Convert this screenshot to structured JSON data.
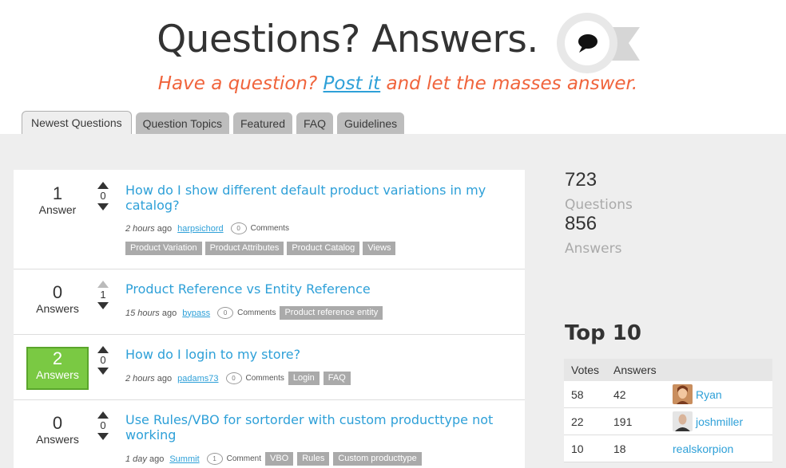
{
  "header": {
    "title": "Questions? Answers.",
    "tagline_before": "Have a question?",
    "tagline_link": "Post it",
    "tagline_after": "and let the masses answer."
  },
  "tabs": [
    {
      "label": "Newest Questions",
      "active": true
    },
    {
      "label": "Question Topics",
      "active": false
    },
    {
      "label": "Featured",
      "active": false
    },
    {
      "label": "FAQ",
      "active": false
    },
    {
      "label": "Guidelines",
      "active": false
    }
  ],
  "questions": [
    {
      "answers": "1",
      "answers_label": "Answer",
      "accepted": false,
      "votes": "0",
      "title": "How do I show different default product variations in my catalog?",
      "ago": "2 hours",
      "ago_suffix": "ago",
      "user": "harpsichord",
      "comments": "0",
      "comments_label": "Comments",
      "tags": [
        "Product Variation",
        "Product Attributes",
        "Product Catalog",
        "Views"
      ]
    },
    {
      "answers": "0",
      "answers_label": "Answers",
      "accepted": false,
      "votes": "1",
      "title": "Product Reference vs Entity Reference",
      "ago": "15 hours",
      "ago_suffix": "ago",
      "user": "bypass",
      "comments": "0",
      "comments_label": "Comments",
      "tags": [
        "Product reference entity"
      ]
    },
    {
      "answers": "2",
      "answers_label": "Answers",
      "accepted": true,
      "votes": "0",
      "title": "How do I login to my store?",
      "ago": "2 hours",
      "ago_suffix": "ago",
      "user": "padams73",
      "comments": "0",
      "comments_label": "Comments",
      "tags": [
        "Login",
        "FAQ"
      ]
    },
    {
      "answers": "0",
      "answers_label": "Answers",
      "accepted": false,
      "votes": "0",
      "title": "Use Rules/VBO for sortorder with custom producttype not working",
      "ago": "1 day",
      "ago_suffix": "ago",
      "user": "Summit",
      "comments": "1",
      "comments_label": "Comment",
      "tags": [
        "VBO",
        "Rules",
        "Custom producttype"
      ]
    }
  ],
  "stats": {
    "questions_count": "723",
    "questions_label": "Questions",
    "answers_count": "856",
    "answers_label": "Answers"
  },
  "top10": {
    "title": "Top 10",
    "col_votes": "Votes",
    "col_answers": "Answers",
    "rows": [
      {
        "votes": "58",
        "answers": "42",
        "user": "Ryan",
        "avatar": true
      },
      {
        "votes": "22",
        "answers": "191",
        "user": "joshmiller",
        "avatar": true
      },
      {
        "votes": "10",
        "answers": "18",
        "user": "realskorpion",
        "avatar": false
      }
    ]
  },
  "colors": {
    "accent": "#2ea0d8",
    "tagline": "#f0643c",
    "accepted": "#7ac943",
    "tag_bg": "#aaaaaa"
  }
}
